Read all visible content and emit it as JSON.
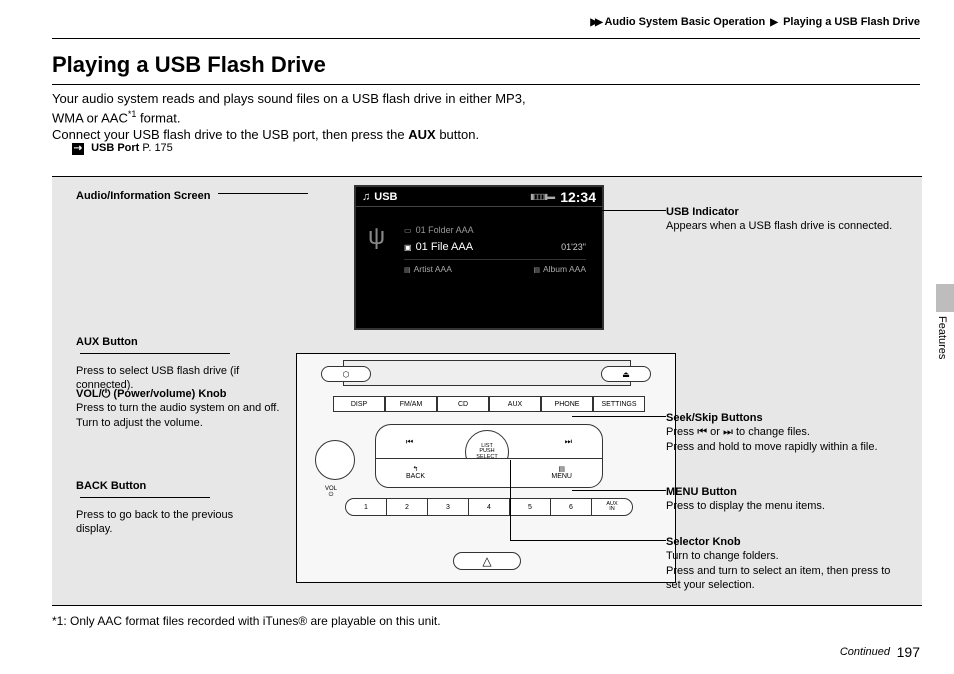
{
  "breadcrumb": {
    "section": "Audio System Basic Operation",
    "page_topic": "Playing a USB Flash Drive"
  },
  "title": "Playing a USB Flash Drive",
  "intro": {
    "line1": "Your audio system reads and plays sound files on a USB flash drive in either MP3,",
    "line2a": "WMA or AAC",
    "line2_sup": "*1",
    "line2b": " format.",
    "line3a": "Connect your USB flash drive to the USB port, then press the ",
    "line3_bold": "AUX",
    "line3b": " button."
  },
  "xref": {
    "label": "USB Port",
    "page": "P. 175"
  },
  "screen": {
    "source": "USB",
    "clock": "12:34",
    "folder": "01  Folder AAA",
    "file": "01 File AAA",
    "elapsed": "01'23\"",
    "artist_label": "Artist AAA",
    "album_label": "Album AAA"
  },
  "unit": {
    "top_left_icon": "⬡",
    "top_right_icon": "⏏",
    "row_buttons": [
      "DISP",
      "FM/AM",
      "CD",
      "AUX",
      "PHONE",
      "SETTINGS"
    ],
    "transport_prev": "⏮",
    "transport_next": "⏭",
    "list_knob_l1": "LIST",
    "list_knob_l2": "PUSH",
    "list_knob_l3": "SELECT",
    "back_icon": "↰",
    "back_label": "BACK",
    "menu_icon": "▤",
    "menu_label": "MENU",
    "vol_l1": "VOL",
    "vol_l2": "⏻",
    "presets": [
      "1",
      "2",
      "3",
      "4",
      "5",
      "6"
    ],
    "preset_last_l1": "AUX",
    "preset_last_l2": "IN",
    "hazard": "△"
  },
  "callouts": {
    "audio_info_screen": "Audio/Information Screen",
    "aux_btn_h": "AUX Button",
    "aux_btn_b": "Press to select USB flash drive (if connected).",
    "vol_h_a": "VOL/",
    "vol_h_icon": "⏻",
    "vol_h_b": " (Power/volume) Knob",
    "vol_b1": "Press to turn the audio system on and off.",
    "vol_b2": "Turn to adjust the volume.",
    "back_h": "BACK Button",
    "back_b": "Press to go back to the previous display.",
    "usb_ind_h": "USB Indicator",
    "usb_ind_b": "Appears when a USB flash drive is connected.",
    "seek_h": "Seek/Skip Buttons",
    "seek_b1a": "Press ",
    "seek_b1_ic1": "⏮",
    "seek_b1_or": " or ",
    "seek_b1_ic2": "⏭",
    "seek_b1b": " to change files.",
    "seek_b2": "Press and hold to move rapidly within a file.",
    "menu_h": "MENU Button",
    "menu_b": "Press to display the menu items.",
    "sel_h": "Selector Knob",
    "sel_b1": "Turn to change folders.",
    "sel_b2": "Press and turn to select an item, then press to set your selection."
  },
  "footnote": "*1: Only AAC format files recorded with iTunes® are playable on this unit.",
  "continued": "Continued",
  "page_number": "197",
  "side_tab": "Features"
}
